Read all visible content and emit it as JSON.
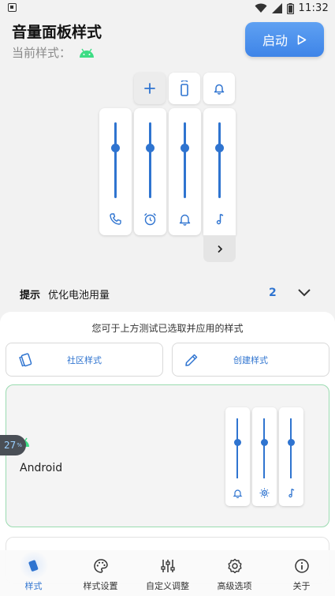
{
  "status_bar": {
    "time": "11:32"
  },
  "header": {
    "title": "音量面板样式",
    "current_style_label": "当前样式：",
    "start_label": "启动"
  },
  "preview": {
    "streams": [
      {
        "name": "call",
        "icon": "phone-icon",
        "level": 0.66
      },
      {
        "name": "alarm",
        "icon": "alarm-icon",
        "level": 0.66
      },
      {
        "name": "ring",
        "icon": "bell-icon",
        "level": 0.66
      },
      {
        "name": "media",
        "icon": "music-note-icon",
        "level": 0.66
      }
    ],
    "top_buttons": [
      "add-icon",
      "vibrate-icon",
      "bell-icon"
    ]
  },
  "tip": {
    "label": "提示",
    "text": "优化电池用量",
    "count": "2"
  },
  "sheet": {
    "hint": "您可于上方测试已选取并应用的样式",
    "community_label": "社区样式",
    "create_label": "创建样式"
  },
  "style_card": {
    "name": "Android",
    "streams": [
      {
        "icon": "bell-icon",
        "level": 0.6
      },
      {
        "icon": "brightness-icon",
        "level": 0.6
      },
      {
        "icon": "music-note-icon",
        "level": 0.6
      }
    ]
  },
  "float_badge": "27",
  "nav": [
    {
      "label": "样式",
      "icon": "style-icon",
      "active": true
    },
    {
      "label": "样式设置",
      "icon": "palette-icon",
      "active": false
    },
    {
      "label": "自定义调整",
      "icon": "sliders-icon",
      "active": false
    },
    {
      "label": "高级选项",
      "icon": "gear-icon",
      "active": false
    },
    {
      "label": "关于",
      "icon": "info-icon",
      "active": false
    }
  ],
  "colors": {
    "accent": "#2f74d0",
    "start_button": "#4a8ded",
    "android_green": "#3ddc84"
  }
}
